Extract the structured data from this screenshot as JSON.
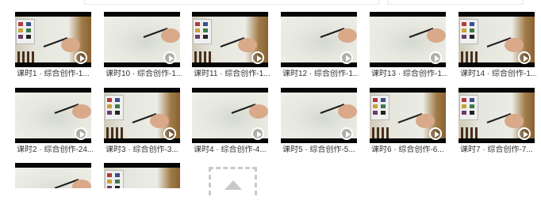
{
  "videos": [
    {
      "label": "课时1 · 综合创作-1...",
      "scene": "palette"
    },
    {
      "label": "课时10 · 综合创作-1...",
      "scene": "drawing"
    },
    {
      "label": "课时11 · 综合创作-1...",
      "scene": "palette"
    },
    {
      "label": "课时12 · 综合创作-1...",
      "scene": "drawing"
    },
    {
      "label": "课时13 · 综合创作-1...",
      "scene": "drawing"
    },
    {
      "label": "课时14 · 综合创作-1...",
      "scene": "palette"
    },
    {
      "label": "课时2 · 综合创作-24...",
      "scene": "drawing"
    },
    {
      "label": "课时3 · 综合创作-3...",
      "scene": "palette"
    },
    {
      "label": "课时4 · 综合创作-4...",
      "scene": "drawing"
    },
    {
      "label": "课时5 · 综合创作-5...",
      "scene": "drawing"
    },
    {
      "label": "课时6 · 综合创作-6...",
      "scene": "palette"
    },
    {
      "label": "课时7 · 综合创作-7...",
      "scene": "palette"
    },
    {
      "label": "",
      "scene": "drawing"
    },
    {
      "label": "",
      "scene": "palette"
    }
  ],
  "icons": {
    "play": "play-icon",
    "upload": "upload-arrow-icon"
  },
  "colors": {
    "thumb_bar": "#060606",
    "paper": "#e9ebe2",
    "label_text": "#333333"
  }
}
